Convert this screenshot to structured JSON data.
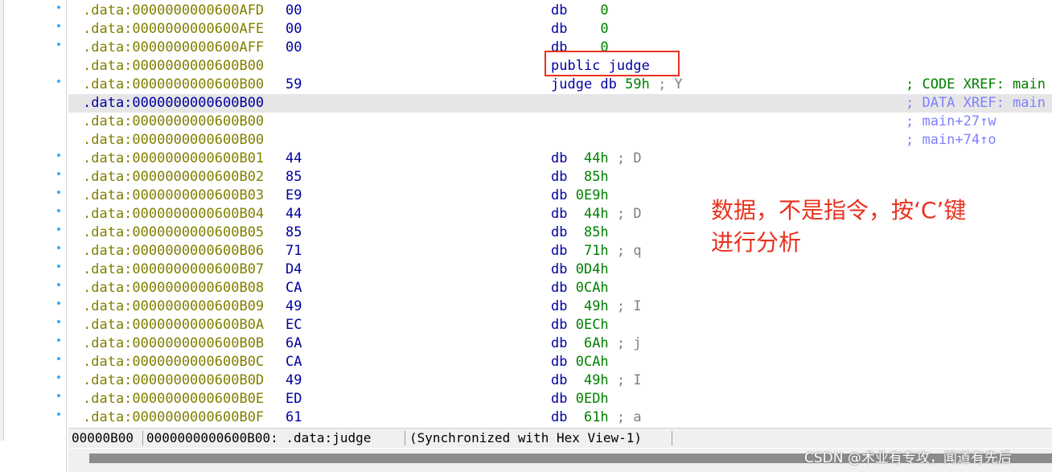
{
  "rows": [
    {
      "addr": ".data:0000000000600AFD",
      "bytes": "00",
      "kw": "db",
      "arg": "    0",
      "comment": "",
      "xref": "",
      "dot": true
    },
    {
      "addr": ".data:0000000000600AFE",
      "bytes": "00",
      "kw": "db",
      "arg": "    0",
      "comment": "",
      "xref": "",
      "dot": true
    },
    {
      "addr": ".data:0000000000600AFF",
      "bytes": "00",
      "kw": "db",
      "arg": "    0",
      "comment": "",
      "xref": "",
      "dot": true
    },
    {
      "addr": ".data:0000000000600B00",
      "bytes": "",
      "kw": "public judge",
      "arg": "",
      "comment": "",
      "xref": "",
      "dot": false
    },
    {
      "addr": ".data:0000000000600B00",
      "bytes": "59",
      "kw": "judge db",
      "arg": " 59h",
      "comment": " ; Y",
      "xref": "; CODE XREF: main",
      "dot": true
    },
    {
      "addr": ".data:0000000000600B00",
      "bytes": "",
      "kw": "",
      "arg": "",
      "comment": "",
      "xref": "; DATA XREF: main",
      "dot": false
    },
    {
      "addr": ".data:0000000000600B00",
      "bytes": "",
      "kw": "",
      "arg": "",
      "comment": "",
      "xref": "; main+27↑w",
      "dot": false
    },
    {
      "addr": ".data:0000000000600B00",
      "bytes": "",
      "kw": "",
      "arg": "",
      "comment": "",
      "xref": "; main+74↑o",
      "dot": false
    },
    {
      "addr": ".data:0000000000600B01",
      "bytes": "44",
      "kw": "db",
      "arg": "  44h",
      "comment": " ; D",
      "xref": "",
      "dot": true
    },
    {
      "addr": ".data:0000000000600B02",
      "bytes": "85",
      "kw": "db",
      "arg": "  85h",
      "comment": "",
      "xref": "",
      "dot": true
    },
    {
      "addr": ".data:0000000000600B03",
      "bytes": "E9",
      "kw": "db",
      "arg": " 0E9h",
      "comment": "",
      "xref": "",
      "dot": true
    },
    {
      "addr": ".data:0000000000600B04",
      "bytes": "44",
      "kw": "db",
      "arg": "  44h",
      "comment": " ; D",
      "xref": "",
      "dot": true
    },
    {
      "addr": ".data:0000000000600B05",
      "bytes": "85",
      "kw": "db",
      "arg": "  85h",
      "comment": "",
      "xref": "",
      "dot": true
    },
    {
      "addr": ".data:0000000000600B06",
      "bytes": "71",
      "kw": "db",
      "arg": "  71h",
      "comment": " ; q",
      "xref": "",
      "dot": true
    },
    {
      "addr": ".data:0000000000600B07",
      "bytes": "D4",
      "kw": "db",
      "arg": " 0D4h",
      "comment": "",
      "xref": "",
      "dot": true
    },
    {
      "addr": ".data:0000000000600B08",
      "bytes": "CA",
      "kw": "db",
      "arg": " 0CAh",
      "comment": "",
      "xref": "",
      "dot": true
    },
    {
      "addr": ".data:0000000000600B09",
      "bytes": "49",
      "kw": "db",
      "arg": "  49h",
      "comment": " ; I",
      "xref": "",
      "dot": true
    },
    {
      "addr": ".data:0000000000600B0A",
      "bytes": "EC",
      "kw": "db",
      "arg": " 0ECh",
      "comment": "",
      "xref": "",
      "dot": true
    },
    {
      "addr": ".data:0000000000600B0B",
      "bytes": "6A",
      "kw": "db",
      "arg": "  6Ah",
      "comment": " ; j",
      "xref": "",
      "dot": true
    },
    {
      "addr": ".data:0000000000600B0C",
      "bytes": "CA",
      "kw": "db",
      "arg": " 0CAh",
      "comment": "",
      "xref": "",
      "dot": true
    },
    {
      "addr": ".data:0000000000600B0D",
      "bytes": "49",
      "kw": "db",
      "arg": "  49h",
      "comment": " ; I",
      "xref": "",
      "dot": true
    },
    {
      "addr": ".data:0000000000600B0E",
      "bytes": "ED",
      "kw": "db",
      "arg": " 0EDh",
      "comment": "",
      "xref": "",
      "dot": true
    },
    {
      "addr": ".data:0000000000600B0F",
      "bytes": "61",
      "kw": "db",
      "arg": "  61h",
      "comment": " ; a",
      "xref": "",
      "dot": true
    }
  ],
  "highlighted_row": 5,
  "annotation": {
    "line1": "数据，不是指令，按‘C’键",
    "line2": "进行分析"
  },
  "status_bar": {
    "offset": "00000B00",
    "location": "0000000000600B00: .data:judge",
    "sync": "(Synchronized with Hex View-1)"
  },
  "watermark": "CSDN @术业有专攻，闻道有先后",
  "colors": {
    "address": "#808000",
    "code_blue": "#0000a0",
    "number_green": "#008000",
    "xref_blue": "#8080ff",
    "annotation_red": "#e8321e",
    "highlight_row": "#e6e6e6"
  }
}
